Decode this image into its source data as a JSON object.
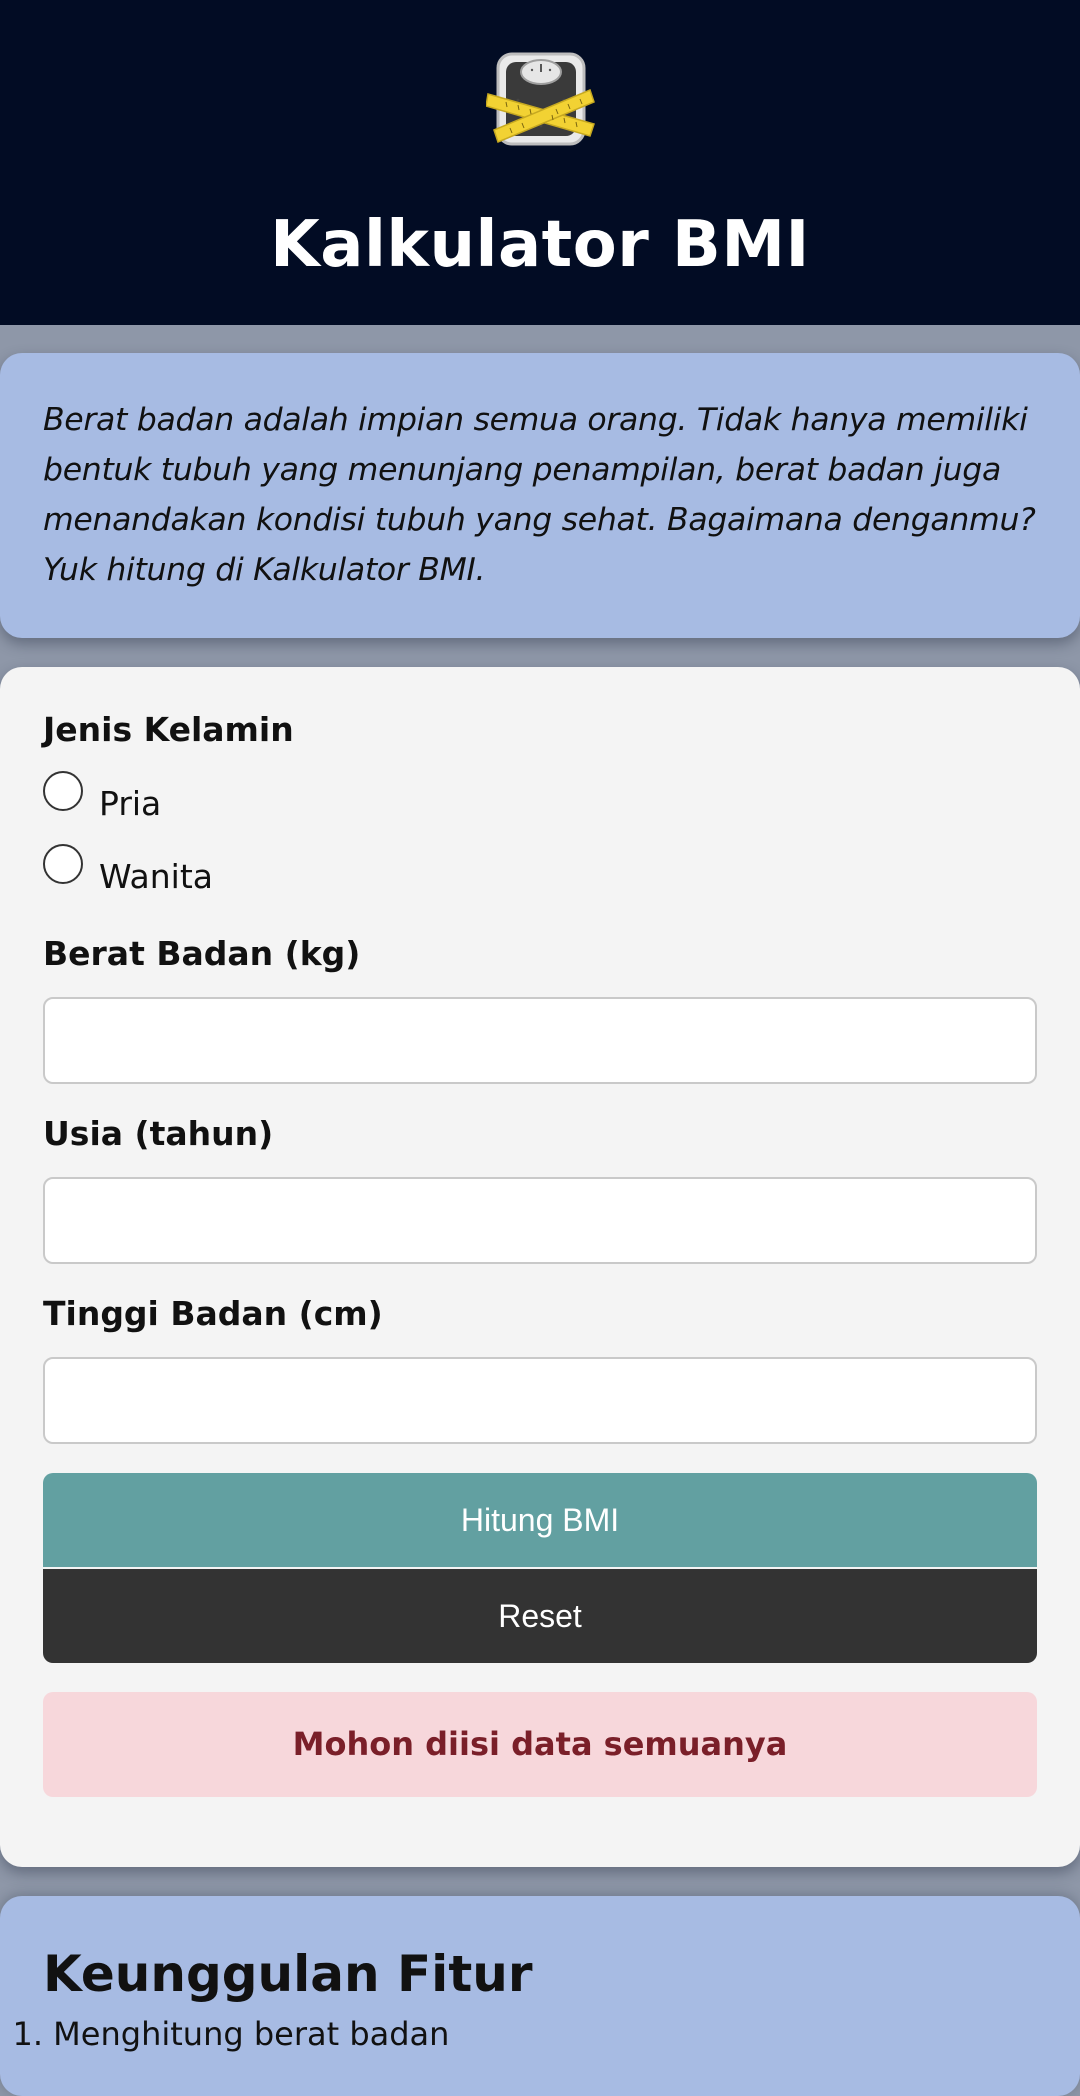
{
  "header": {
    "logo_icon": "scale-with-measuring-tape-icon",
    "title": "Kalkulator BMI",
    "background_color": "#020c24"
  },
  "intro": {
    "text": "Berat badan adalah impian semua orang. Tidak hanya memiliki bentuk tubuh yang menunjang penampilan, berat badan juga menandakan kondisi tubuh yang sehat. Bagaimana denganmu? Yuk hitung di Kalkulator BMI."
  },
  "form": {
    "gender_label": "Jenis Kelamin",
    "gender_options": [
      {
        "label": "Pria",
        "selected": false
      },
      {
        "label": "Wanita",
        "selected": false
      }
    ],
    "weight_label": "Berat Badan (kg)",
    "weight_value": "",
    "age_label": "Usia (tahun)",
    "age_value": "",
    "height_label": "Tinggi Badan (cm)",
    "height_value": "",
    "calculate_label": "Hitung BMI",
    "reset_label": "Reset",
    "alert_text": "Mohon diisi data semuanya"
  },
  "features": {
    "title": "Keunggulan Fitur",
    "items": [
      {
        "number": "1.",
        "text": "Menghitung berat badan"
      }
    ]
  },
  "colors": {
    "card_blue": "#a7bbe3",
    "button_teal": "#62a0a1",
    "button_dark": "#333333",
    "alert_bg": "#f7d7db",
    "alert_text": "#7a1f29"
  }
}
